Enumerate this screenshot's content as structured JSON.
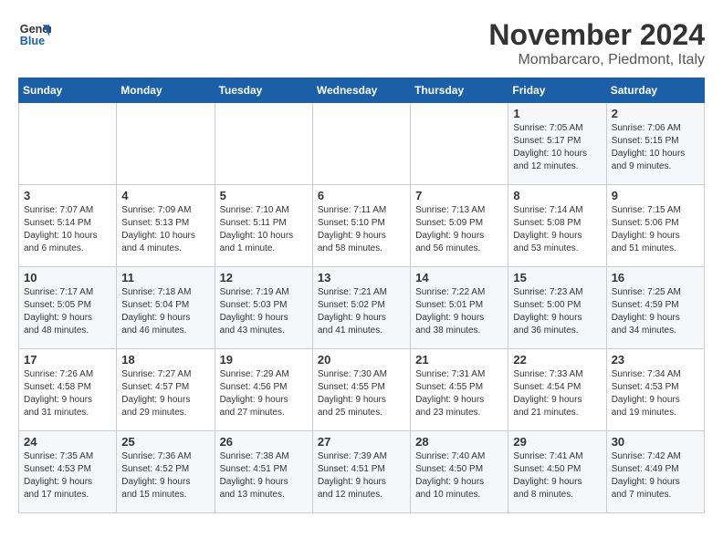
{
  "header": {
    "logo_line1": "General",
    "logo_line2": "Blue",
    "month": "November 2024",
    "location": "Mombarcaro, Piedmont, Italy"
  },
  "weekdays": [
    "Sunday",
    "Monday",
    "Tuesday",
    "Wednesday",
    "Thursday",
    "Friday",
    "Saturday"
  ],
  "weeks": [
    [
      {
        "day": "",
        "info": ""
      },
      {
        "day": "",
        "info": ""
      },
      {
        "day": "",
        "info": ""
      },
      {
        "day": "",
        "info": ""
      },
      {
        "day": "",
        "info": ""
      },
      {
        "day": "1",
        "info": "Sunrise: 7:05 AM\nSunset: 5:17 PM\nDaylight: 10 hours\nand 12 minutes."
      },
      {
        "day": "2",
        "info": "Sunrise: 7:06 AM\nSunset: 5:15 PM\nDaylight: 10 hours\nand 9 minutes."
      }
    ],
    [
      {
        "day": "3",
        "info": "Sunrise: 7:07 AM\nSunset: 5:14 PM\nDaylight: 10 hours\nand 6 minutes."
      },
      {
        "day": "4",
        "info": "Sunrise: 7:09 AM\nSunset: 5:13 PM\nDaylight: 10 hours\nand 4 minutes."
      },
      {
        "day": "5",
        "info": "Sunrise: 7:10 AM\nSunset: 5:11 PM\nDaylight: 10 hours\nand 1 minute."
      },
      {
        "day": "6",
        "info": "Sunrise: 7:11 AM\nSunset: 5:10 PM\nDaylight: 9 hours\nand 58 minutes."
      },
      {
        "day": "7",
        "info": "Sunrise: 7:13 AM\nSunset: 5:09 PM\nDaylight: 9 hours\nand 56 minutes."
      },
      {
        "day": "8",
        "info": "Sunrise: 7:14 AM\nSunset: 5:08 PM\nDaylight: 9 hours\nand 53 minutes."
      },
      {
        "day": "9",
        "info": "Sunrise: 7:15 AM\nSunset: 5:06 PM\nDaylight: 9 hours\nand 51 minutes."
      }
    ],
    [
      {
        "day": "10",
        "info": "Sunrise: 7:17 AM\nSunset: 5:05 PM\nDaylight: 9 hours\nand 48 minutes."
      },
      {
        "day": "11",
        "info": "Sunrise: 7:18 AM\nSunset: 5:04 PM\nDaylight: 9 hours\nand 46 minutes."
      },
      {
        "day": "12",
        "info": "Sunrise: 7:19 AM\nSunset: 5:03 PM\nDaylight: 9 hours\nand 43 minutes."
      },
      {
        "day": "13",
        "info": "Sunrise: 7:21 AM\nSunset: 5:02 PM\nDaylight: 9 hours\nand 41 minutes."
      },
      {
        "day": "14",
        "info": "Sunrise: 7:22 AM\nSunset: 5:01 PM\nDaylight: 9 hours\nand 38 minutes."
      },
      {
        "day": "15",
        "info": "Sunrise: 7:23 AM\nSunset: 5:00 PM\nDaylight: 9 hours\nand 36 minutes."
      },
      {
        "day": "16",
        "info": "Sunrise: 7:25 AM\nSunset: 4:59 PM\nDaylight: 9 hours\nand 34 minutes."
      }
    ],
    [
      {
        "day": "17",
        "info": "Sunrise: 7:26 AM\nSunset: 4:58 PM\nDaylight: 9 hours\nand 31 minutes."
      },
      {
        "day": "18",
        "info": "Sunrise: 7:27 AM\nSunset: 4:57 PM\nDaylight: 9 hours\nand 29 minutes."
      },
      {
        "day": "19",
        "info": "Sunrise: 7:29 AM\nSunset: 4:56 PM\nDaylight: 9 hours\nand 27 minutes."
      },
      {
        "day": "20",
        "info": "Sunrise: 7:30 AM\nSunset: 4:55 PM\nDaylight: 9 hours\nand 25 minutes."
      },
      {
        "day": "21",
        "info": "Sunrise: 7:31 AM\nSunset: 4:55 PM\nDaylight: 9 hours\nand 23 minutes."
      },
      {
        "day": "22",
        "info": "Sunrise: 7:33 AM\nSunset: 4:54 PM\nDaylight: 9 hours\nand 21 minutes."
      },
      {
        "day": "23",
        "info": "Sunrise: 7:34 AM\nSunset: 4:53 PM\nDaylight: 9 hours\nand 19 minutes."
      }
    ],
    [
      {
        "day": "24",
        "info": "Sunrise: 7:35 AM\nSunset: 4:53 PM\nDaylight: 9 hours\nand 17 minutes."
      },
      {
        "day": "25",
        "info": "Sunrise: 7:36 AM\nSunset: 4:52 PM\nDaylight: 9 hours\nand 15 minutes."
      },
      {
        "day": "26",
        "info": "Sunrise: 7:38 AM\nSunset: 4:51 PM\nDaylight: 9 hours\nand 13 minutes."
      },
      {
        "day": "27",
        "info": "Sunrise: 7:39 AM\nSunset: 4:51 PM\nDaylight: 9 hours\nand 12 minutes."
      },
      {
        "day": "28",
        "info": "Sunrise: 7:40 AM\nSunset: 4:50 PM\nDaylight: 9 hours\nand 10 minutes."
      },
      {
        "day": "29",
        "info": "Sunrise: 7:41 AM\nSunset: 4:50 PM\nDaylight: 9 hours\nand 8 minutes."
      },
      {
        "day": "30",
        "info": "Sunrise: 7:42 AM\nSunset: 4:49 PM\nDaylight: 9 hours\nand 7 minutes."
      }
    ]
  ]
}
